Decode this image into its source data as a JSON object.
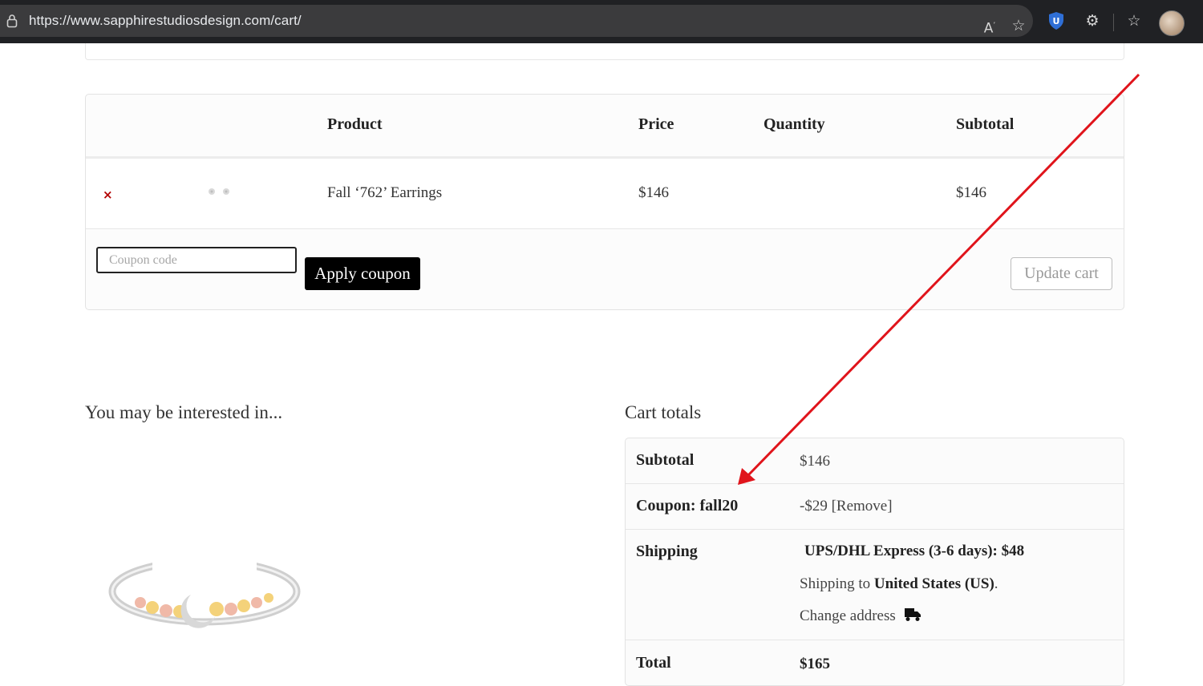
{
  "browser": {
    "url": "https://www.sapphirestudiosdesign.com/cart/",
    "icons": [
      "lock-icon",
      "read-aloud-icon",
      "favorite-star-icon",
      "shield-extension-icon",
      "extensions-icon",
      "favorites-icon",
      "profile-avatar"
    ]
  },
  "cart_table": {
    "headers": {
      "product": "Product",
      "price": "Price",
      "quantity": "Quantity",
      "subtotal": "Subtotal"
    },
    "items": [
      {
        "remove": "×",
        "product": "Fall ‘762’ Earrings",
        "price": "$146",
        "quantity": "",
        "subtotal": "$146"
      }
    ],
    "coupon_placeholder": "Coupon code",
    "apply_coupon": "Apply coupon",
    "update_cart": "Update cart"
  },
  "interested": {
    "title": "You may be interested in..."
  },
  "cart_totals": {
    "title": "Cart totals",
    "subtotal_label": "Subtotal",
    "subtotal_value": "$146",
    "coupon_label": "Coupon: fall20",
    "coupon_value": "-$29 [Remove]",
    "shipping_label": "Shipping",
    "shipping_method": "UPS/DHL Express (3-6 days): $48",
    "shipping_to_prefix": "Shipping to",
    "shipping_to_country": "United States (US)",
    "shipping_to_suffix": ".",
    "change_address": "Change address",
    "total_label": "Total",
    "total_value": "$165"
  },
  "annotation": {
    "color": "#e0141b"
  }
}
